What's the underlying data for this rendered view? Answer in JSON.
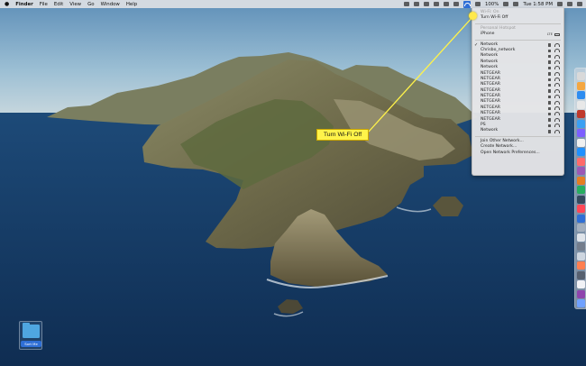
{
  "menubar": {
    "apple": "",
    "app_name": "Finder",
    "menus": [
      "File",
      "Edit",
      "View",
      "Go",
      "Window",
      "Help"
    ],
    "battery_percent": "100%",
    "clock": "Tue 1:58 PM",
    "status_icons": [
      "wifi-icon",
      "battery-icon",
      "search-icon",
      "siri-icon",
      "notification-icon"
    ]
  },
  "wifi_menu": {
    "status": "Wi-Fi: On",
    "toggle_label": "Turn Wi-Fi Off",
    "personal_hotspot_header": "Personal Hotspot",
    "personal_hotspot_device": "iPhone",
    "personal_hotspot_signal": "LTE",
    "networks": [
      {
        "name": "Network",
        "connected": true
      },
      {
        "name": "Chrisbo_network",
        "connected": false
      },
      {
        "name": "Network",
        "connected": false
      },
      {
        "name": "Network",
        "connected": false
      },
      {
        "name": "Network",
        "connected": false
      },
      {
        "name": "NETGEAR",
        "connected": false
      },
      {
        "name": "NETGEAR",
        "connected": false
      },
      {
        "name": "NETGEAR",
        "connected": false
      },
      {
        "name": "NETGEAR",
        "connected": false
      },
      {
        "name": "NETGEAR",
        "connected": false
      },
      {
        "name": "NETGEAR",
        "connected": false
      },
      {
        "name": "NETGEAR",
        "connected": false
      },
      {
        "name": "NETGEAR",
        "connected": false
      },
      {
        "name": "NETGEAR",
        "connected": false
      },
      {
        "name": "PS",
        "connected": false
      },
      {
        "name": "Network",
        "connected": false
      }
    ],
    "join_other": "Join Other Network...",
    "create_network": "Create Network...",
    "open_prefs": "Open Network Preferences..."
  },
  "callout": {
    "text": "Turn Wi-Fi Off"
  },
  "desktop": {
    "folder_label": "Sort Me"
  },
  "colors": {
    "callout_yellow": "#fff34a",
    "menu_highlight": "#2f6fd6",
    "folder_blue": "#4fa6e0"
  }
}
